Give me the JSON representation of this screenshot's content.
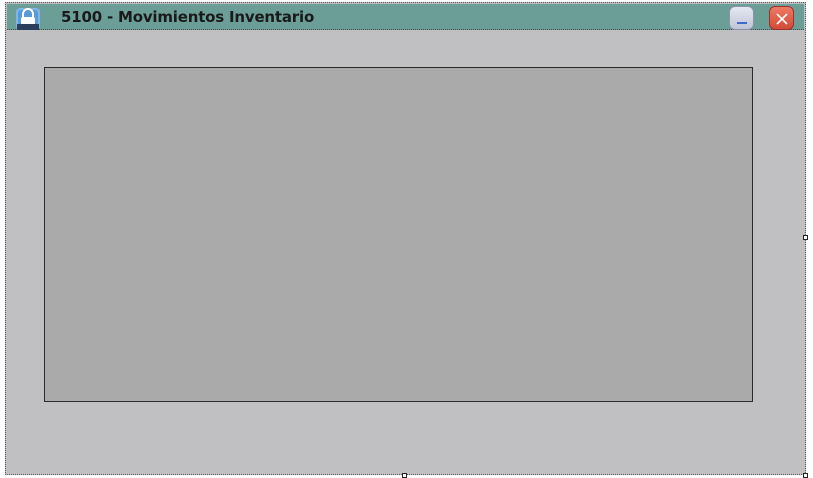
{
  "window": {
    "title": "5100 - Movimientos Inventario",
    "icon": "lock-icon",
    "minimize_icon": "minimize-icon",
    "close_icon": "close-icon"
  },
  "colors": {
    "title_bar": "#6b9e97",
    "form_background": "#c0c0c2",
    "panel_background": "#aaaaaa",
    "close_button": "#d24a36"
  }
}
